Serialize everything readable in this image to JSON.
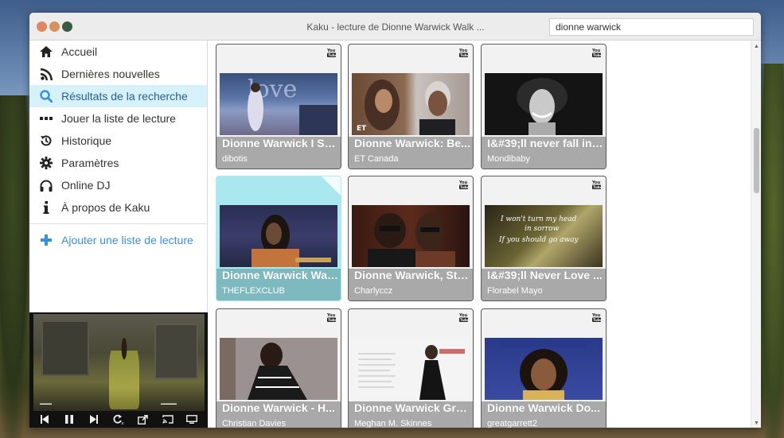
{
  "window": {
    "title": "Kaku - lecture de Dionne Warwick Walk ...",
    "search_value": "dionne warwick",
    "search_placeholder": ""
  },
  "sidebar": {
    "items": [
      {
        "label": "Accueil",
        "icon": "home-icon"
      },
      {
        "label": "Dernières nouvelles",
        "icon": "rss-icon"
      },
      {
        "label": "Résultats de la recherche",
        "icon": "search-icon",
        "active": true
      },
      {
        "label": "Jouer la liste de lecture",
        "icon": "ellipsis-icon"
      },
      {
        "label": "Historique",
        "icon": "history-icon"
      },
      {
        "label": "Paramètres",
        "icon": "gear-icon"
      },
      {
        "label": "Online DJ",
        "icon": "headphones-icon"
      },
      {
        "label": "À propos de Kaku",
        "icon": "info-icon"
      }
    ],
    "add_playlist_label": "Ajouter une liste de lecture"
  },
  "player": {
    "controls": [
      "previous-icon",
      "pause-icon",
      "next-icon",
      "repeat-icon",
      "popout-icon",
      "cast-icon",
      "tv-icon"
    ]
  },
  "results": [
    {
      "title": "Dionne Warwick I Sa...",
      "channel": "dibotis",
      "source": "youtube"
    },
    {
      "title": "Dionne Warwick: Be...",
      "channel": "ET Canada",
      "source": "youtube"
    },
    {
      "title": "I&#39;ll never fall in l...",
      "channel": "Mondibaby",
      "source": "youtube"
    },
    {
      "title": "Dionne Warwick Wal...",
      "channel": "THEFLEXCLUB",
      "source": "youtube",
      "selected": true
    },
    {
      "title": "Dionne Warwick, Ste...",
      "channel": "Charlyccz",
      "source": "youtube"
    },
    {
      "title": "I&#39;ll Never Love ...",
      "channel": "Florabel Mayo",
      "source": "youtube"
    },
    {
      "title": "Dionne Warwick - H...",
      "channel": "Christian Davies",
      "source": "youtube"
    },
    {
      "title": "Dionne Warwick Gre...",
      "channel": "Meghan M. Skinnes",
      "source": "youtube"
    },
    {
      "title": "Dionne Warwick Do...",
      "channel": "greatgarrett2",
      "source": "youtube"
    }
  ],
  "colors": {
    "active_nav_bg": "#d6f1fa",
    "accent_blue": "#3b8fd4",
    "selected_card": "#a8e8ee",
    "card_info_bg": "#a9a9a9"
  }
}
